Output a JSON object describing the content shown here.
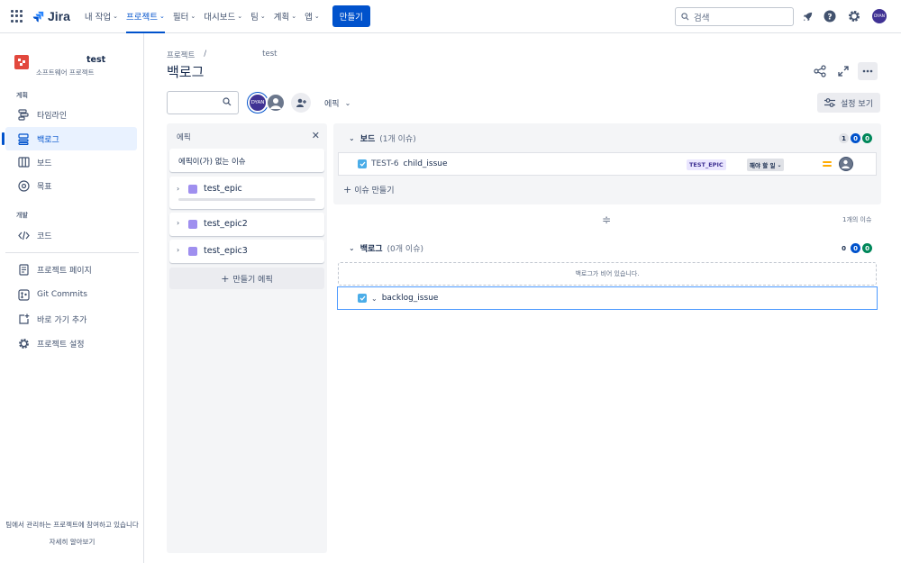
{
  "topnav": {
    "app_name": "Jira",
    "items": [
      {
        "label": "내 작업"
      },
      {
        "label": "프로젝트"
      },
      {
        "label": "필터"
      },
      {
        "label": "대시보드"
      },
      {
        "label": "팀"
      },
      {
        "label": "계획"
      },
      {
        "label": "앱"
      }
    ],
    "create_label": "만들기",
    "search_placeholder": "검색",
    "avatar_initials": "DYAN"
  },
  "sidebar": {
    "project_name": "test",
    "project_type": "소프트웨어 프로젝트",
    "section_plan": "계획",
    "section_dev": "개발",
    "items": [
      {
        "label": "타임라인",
        "icon": "timeline-icon"
      },
      {
        "label": "백로그",
        "icon": "backlog-icon",
        "active": true
      },
      {
        "label": "보드",
        "icon": "board-icon"
      },
      {
        "label": "목표",
        "icon": "goals-icon"
      },
      {
        "label": "코드",
        "icon": "code-icon"
      },
      {
        "label": "프로젝트 페이지",
        "icon": "page-icon"
      },
      {
        "label": "Git Commits",
        "icon": "git-icon"
      },
      {
        "label": "바로 가기 추가",
        "icon": "add-shortcut-icon"
      },
      {
        "label": "프로젝트 설정",
        "icon": "settings-icon"
      }
    ],
    "footer_text": "팀에서 관리하는 프로젝트에 참여하고 있습니다",
    "footer_link": "자세히 알아보기"
  },
  "header": {
    "breadcrumb_root": "프로젝트",
    "breadcrumb_sep": "/",
    "breadcrumb_project": "test",
    "title": "백로그"
  },
  "toolbar": {
    "avatar_initials": "DYAN",
    "epic_filter_label": "에픽",
    "view_settings_label": "설정 보기"
  },
  "epic_panel": {
    "title": "에픽",
    "no_epic_label": "에픽이(가) 없는 이슈",
    "epics": [
      {
        "name": "test_epic",
        "progress": 0
      },
      {
        "name": "test_epic2"
      },
      {
        "name": "test_epic3"
      }
    ],
    "create_epic_label": "만들기 에픽"
  },
  "board_section": {
    "title": "보드",
    "count_label": "(1개 이슈)",
    "counts": [
      "1",
      "0",
      "0"
    ],
    "issues": [
      {
        "key": "TEST-6",
        "summary": "child_issue",
        "epic": "TEST_EPIC",
        "status": "해야 할 일"
      }
    ],
    "create_issue_label": "이슈 만들기"
  },
  "issue_total_label": "1개의 이슈",
  "backlog_section": {
    "title": "백로그",
    "count_label": "(0개 이슈)",
    "counts": [
      "0",
      "0",
      "0"
    ],
    "empty_text": "백로그가 비어 있습니다.",
    "new_issue_text": "backlog_issue"
  },
  "colors": {
    "brand": "#0052cc",
    "epic_purple": "#9f8fef",
    "done_green": "#00875a",
    "priority_medium": "#ffab00"
  }
}
